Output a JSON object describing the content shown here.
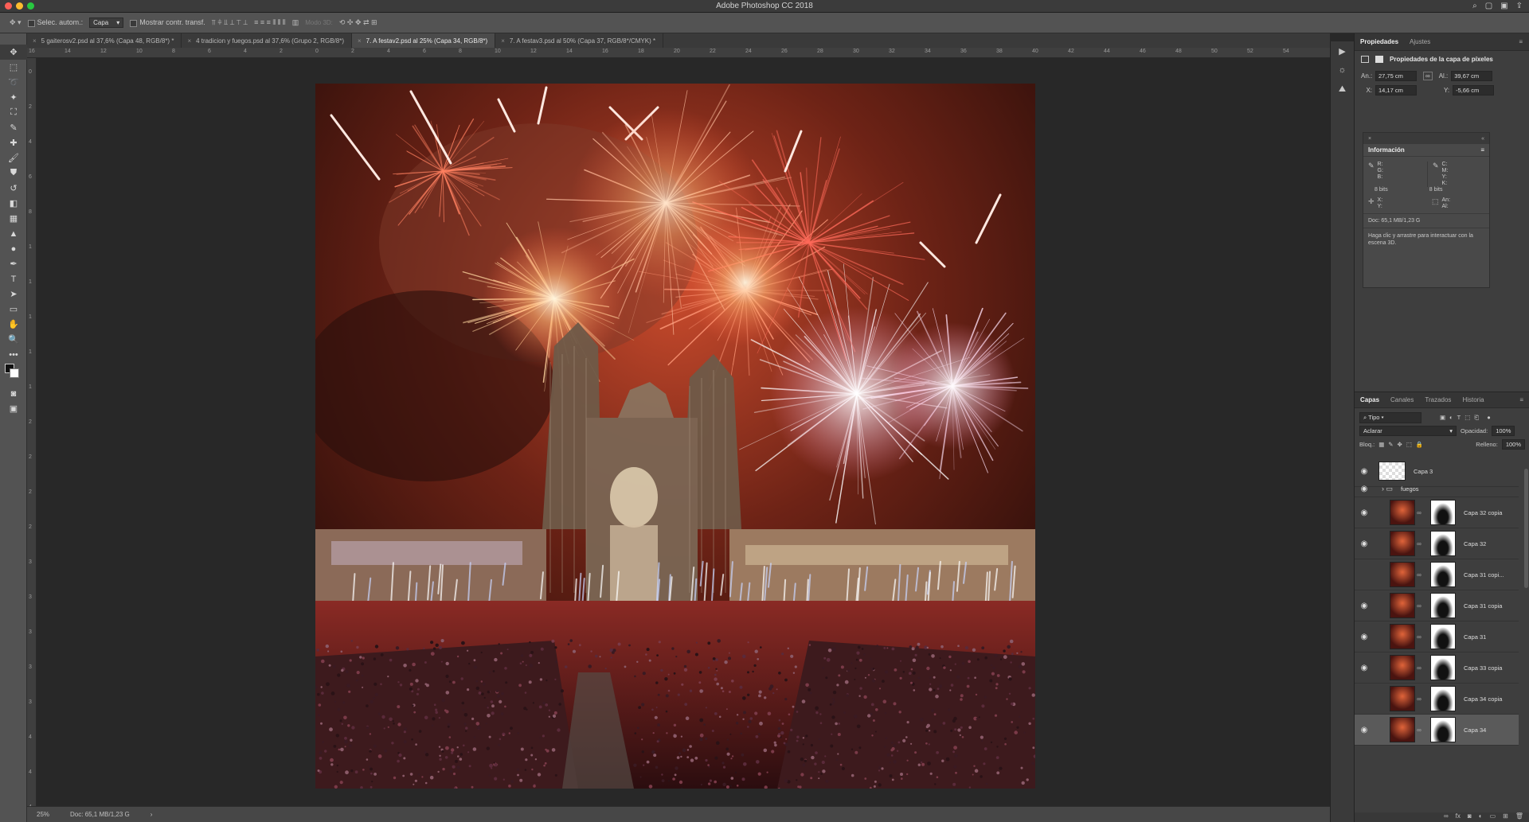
{
  "app": {
    "title": "Adobe Photoshop CC 2018"
  },
  "options": {
    "auto_select_label": "Selec. autom.:",
    "auto_select_value": "Capa",
    "show_transform_label": "Mostrar contr. transf.",
    "mode3d_label": "Modo 3D:"
  },
  "tabs": [
    {
      "label": "5 gaiterosv2.psd al 37,6% (Capa 48, RGB/8*) *"
    },
    {
      "label": "4 tradicion y fuegos.psd al 37,6% (Grupo 2, RGB/8*)"
    },
    {
      "label": "7. A festav2.psd al 25% (Capa 34, RGB/8*)"
    },
    {
      "label": "7. A festav3.psd al 50% (Capa 37, RGB/8*/CMYK) *"
    }
  ],
  "ruler_top": [
    "16",
    "14",
    "12",
    "10",
    "8",
    "6",
    "4",
    "2",
    "0",
    "2",
    "4",
    "6",
    "8",
    "10",
    "12",
    "14",
    "16",
    "18",
    "20",
    "22",
    "24",
    "26",
    "28",
    "30",
    "32",
    "34",
    "36",
    "38",
    "40",
    "42",
    "44",
    "46",
    "48",
    "50",
    "52",
    "54"
  ],
  "ruler_left": [
    "0",
    "2",
    "4",
    "6",
    "8",
    "1",
    "1",
    "1",
    "1",
    "1",
    "2",
    "2",
    "2",
    "2",
    "3",
    "3",
    "3",
    "3",
    "3",
    "4",
    "4",
    "4"
  ],
  "status": {
    "zoom": "25%",
    "doc": "Doc: 65,1 MB/1,23 G"
  },
  "properties": {
    "tab_active": "Propiedades",
    "tab_other": "Ajustes",
    "section_title": "Propiedades de la capa de píxeles",
    "w_label": "An.:",
    "w_value": "27,75 cm",
    "h_label": "Al.:",
    "h_value": "39,67 cm",
    "x_label": "X:",
    "x_value": "14,17 cm",
    "y_label": "Y:",
    "y_value": "-5,66 cm"
  },
  "info": {
    "title": "Información",
    "rgb": "R:\nG:\nB:",
    "cmyk": "C:\nM:\nY:\nK:",
    "bits_left": "8 bits",
    "bits_right": "8 bits",
    "xy": "X:\nY:",
    "wh": "An:\nAl:",
    "doc": "Doc: 65,1 MB/1,23 G",
    "hint": "Haga clic y arrastre para interactuar con la escena 3D."
  },
  "layers_panel": {
    "tabs": [
      "Capas",
      "Canales",
      "Trazados",
      "Historia"
    ],
    "filter": "Tipo",
    "blend_mode": "Aclarar",
    "opacity_label": "Opacidad:",
    "opacity_value": "100%",
    "lock_label": "Bloq.:",
    "fill_label": "Relleno:",
    "fill_value": "100%",
    "layers": [
      {
        "name": "Capa 3",
        "visible": true,
        "kind": "layer"
      },
      {
        "name": "fuegos",
        "visible": true,
        "kind": "group"
      },
      {
        "name": "Capa 32 copia",
        "visible": true,
        "kind": "masked"
      },
      {
        "name": "Capa 32",
        "visible": true,
        "kind": "masked"
      },
      {
        "name": "Capa 31 copi...",
        "visible": false,
        "kind": "masked"
      },
      {
        "name": "Capa 31 copia",
        "visible": true,
        "kind": "masked"
      },
      {
        "name": "Capa 31",
        "visible": true,
        "kind": "masked"
      },
      {
        "name": "Capa 33 copia",
        "visible": true,
        "kind": "masked"
      },
      {
        "name": "Capa 34 copia",
        "visible": false,
        "kind": "masked"
      },
      {
        "name": "Capa 34",
        "visible": true,
        "kind": "masked",
        "selected": true
      }
    ]
  }
}
